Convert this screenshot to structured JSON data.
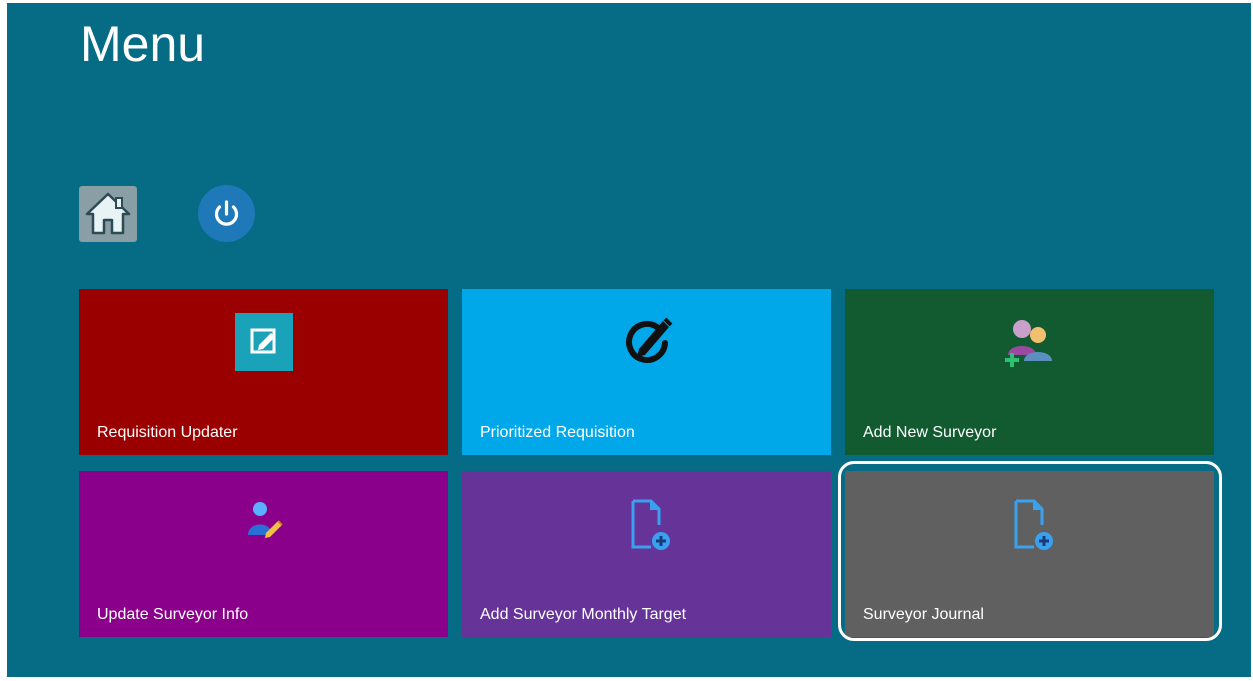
{
  "page": {
    "title": "Menu"
  },
  "toolbar": {
    "home_icon": "home-icon",
    "power_icon": "power-icon"
  },
  "tiles": [
    {
      "label": "Requisition Updater",
      "icon": "edit-icon",
      "color": "#9a0000"
    },
    {
      "label": "Prioritized Requisition",
      "icon": "pencil-circle-icon",
      "color": "#00a8ea"
    },
    {
      "label": "Add New Surveyor",
      "icon": "add-users-icon",
      "color": "#125a2f"
    },
    {
      "label": "Update Surveyor Info",
      "icon": "user-edit-icon",
      "color": "#8a008a"
    },
    {
      "label": "Add Surveyor Monthly Target",
      "icon": "add-document-icon",
      "color": "#663399"
    },
    {
      "label": "Surveyor Journal",
      "icon": "add-document-icon",
      "color": "#606060",
      "selected": true
    }
  ],
  "colors": {
    "background": "#066c85",
    "accent": "#1f79b8"
  }
}
